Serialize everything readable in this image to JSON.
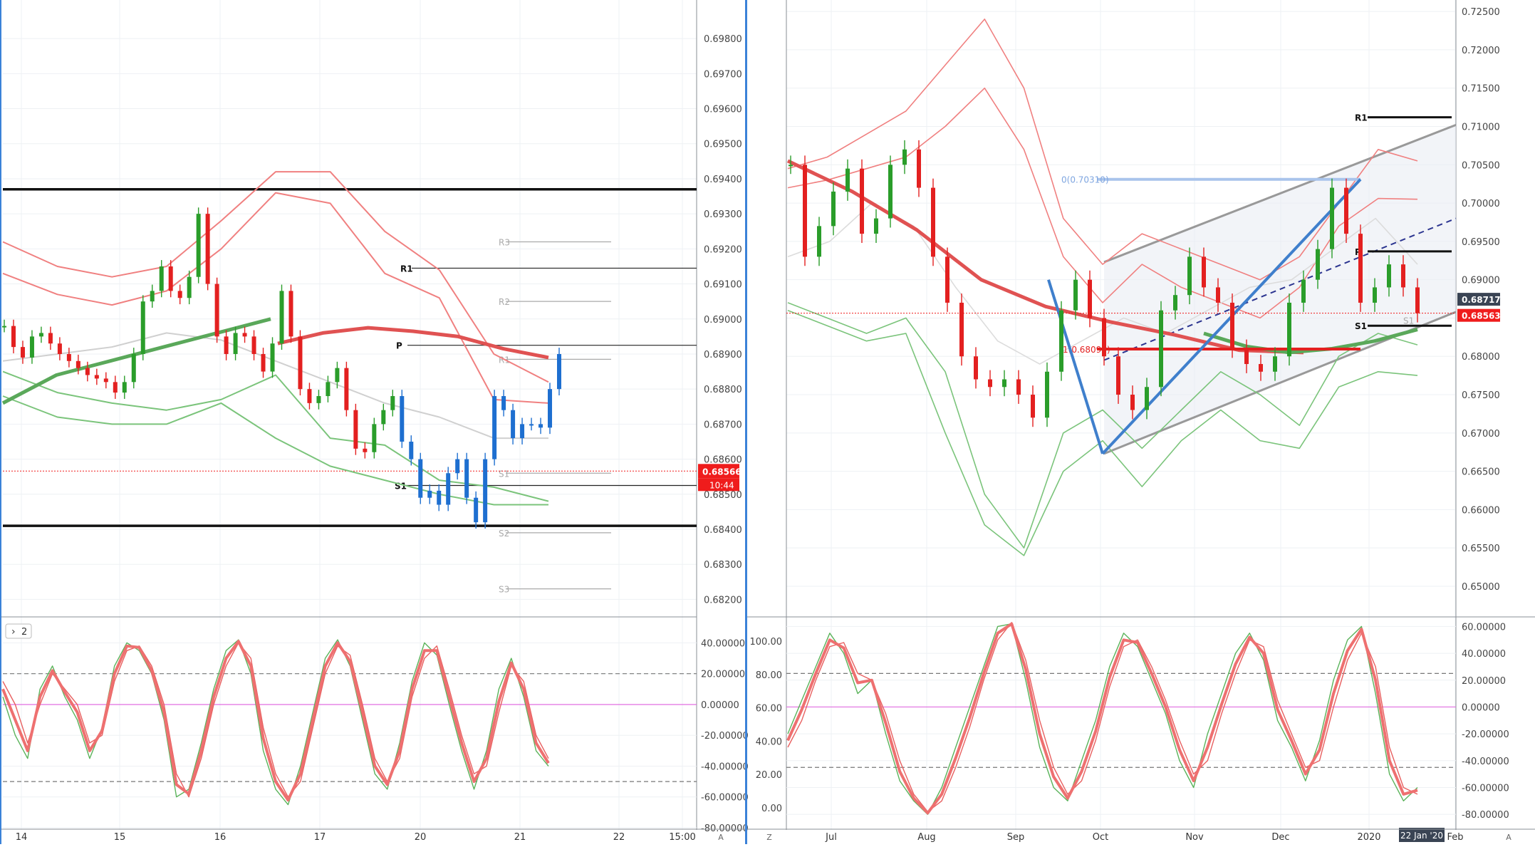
{
  "chart_data": [
    {
      "type": "candlestick",
      "panel": "left-main",
      "price_axis": {
        "ticks": [
          "0.69800",
          "0.69700",
          "0.69600",
          "0.69500",
          "0.69400",
          "0.69300",
          "0.69200",
          "0.69100",
          "0.69000",
          "0.68900",
          "0.68800",
          "0.68700",
          "0.68600",
          "0.68500",
          "0.68400",
          "0.68300",
          "0.68200"
        ],
        "ylim": [
          0.6815,
          0.6991
        ]
      },
      "time_axis": {
        "ticks": [
          "14",
          "15",
          "16",
          "17",
          "20",
          "21",
          "22",
          "15:00"
        ],
        "end_label": "A"
      },
      "current_price": {
        "value": 0.68566,
        "label": "0.68566",
        "countdown": "10:44",
        "color": "#ef1c1c"
      },
      "pivots": {
        "dark": [
          {
            "label": "R1",
            "value": 0.69145
          },
          {
            "label": "P",
            "value": 0.68925
          },
          {
            "label": "S1",
            "value": 0.68525
          }
        ],
        "gray": [
          {
            "label": "R3",
            "value": 0.6922
          },
          {
            "label": "R2",
            "value": 0.6905
          },
          {
            "label": "R1",
            "value": 0.68885
          },
          {
            "label": "S1",
            "value": 0.6856
          },
          {
            "label": "S2",
            "value": 0.6839
          },
          {
            "label": "S3",
            "value": 0.6823
          }
        ],
        "thick_horizontals": [
          0.6937,
          0.6841
        ]
      },
      "price_path": [
        0.6898,
        0.6892,
        0.6889,
        0.6895,
        0.6896,
        0.6893,
        0.689,
        0.6888,
        0.6886,
        0.6884,
        0.6883,
        0.6882,
        0.6879,
        0.6882,
        0.689,
        0.6905,
        0.6908,
        0.6915,
        0.6908,
        0.6906,
        0.6912,
        0.693,
        0.691,
        0.6895,
        0.689,
        0.6896,
        0.6895,
        0.689,
        0.6885,
        0.6893,
        0.6908,
        0.6895,
        0.688,
        0.6876,
        0.6878,
        0.6882,
        0.6886,
        0.6874,
        0.6863,
        0.6862,
        0.687,
        0.6874,
        0.6878,
        0.6865,
        0.686,
        0.6849,
        0.6851,
        0.6847,
        0.6856,
        0.686,
        0.6849,
        0.6842,
        0.686,
        0.6878,
        0.6874,
        0.6866,
        0.687,
        0.687,
        0.6869,
        0.688,
        0.689
      ],
      "overlays": {
        "ma_red": [
          0.6893,
          0.6896,
          0.68975,
          0.68965,
          0.6895,
          0.68915,
          0.6889
        ],
        "ma_green": [
          0.6876,
          0.6884,
          0.6888,
          0.6892,
          0.6896,
          0.69
        ],
        "bands_red": [
          [
            0.6922,
            0.6915,
            0.6912,
            0.6915,
            0.6928,
            0.6942,
            0.6942,
            0.6925,
            0.6914,
            0.689,
            0.6882
          ],
          [
            0.6913,
            0.6907,
            0.6904,
            0.6908,
            0.692,
            0.6936,
            0.6933,
            0.6913,
            0.6906,
            0.6877,
            0.6876
          ]
        ],
        "bands_green": [
          [
            0.6885,
            0.6879,
            0.6876,
            0.6874,
            0.6877,
            0.6884,
            0.6866,
            0.6864,
            0.6854,
            0.6852,
            0.6848
          ],
          [
            0.6878,
            0.6872,
            0.687,
            0.687,
            0.6876,
            0.6866,
            0.6858,
            0.6854,
            0.685,
            0.6847,
            0.6847
          ]
        ]
      },
      "oscillator": {
        "panel_label": "2",
        "ticks": [
          "40.00000",
          "20.00000",
          "0.00000",
          "-20.00000",
          "-40.00000",
          "-60.00000",
          "-80.00000"
        ],
        "ylim": [
          -80,
          55
        ],
        "dashed_levels": [
          20,
          -50
        ],
        "zero_line_color": "#e06ee0",
        "fast_line": [
          5,
          -20,
          -35,
          10,
          25,
          5,
          -10,
          -35,
          -15,
          25,
          40,
          35,
          20,
          -10,
          -60,
          -55,
          -25,
          10,
          35,
          42,
          20,
          -30,
          -55,
          -65,
          -40,
          -5,
          30,
          42,
          25,
          -10,
          -45,
          -55,
          -25,
          15,
          40,
          32,
          0,
          -30,
          -55,
          -30,
          10,
          30,
          5,
          -30,
          -40
        ],
        "slow_line": [
          15,
          0,
          -25,
          0,
          20,
          10,
          0,
          -25,
          -20,
          15,
          35,
          38,
          25,
          0,
          -45,
          -60,
          -35,
          0,
          25,
          40,
          30,
          -15,
          -45,
          -60,
          -50,
          -15,
          20,
          38,
          32,
          0,
          -35,
          -50,
          -35,
          5,
          30,
          38,
          10,
          -20,
          -45,
          -40,
          -5,
          25,
          15,
          -20,
          -35
        ],
        "main_line": [
          10,
          -10,
          -30,
          5,
          22,
          8,
          -5,
          -30,
          -17,
          20,
          38,
          37,
          22,
          -5,
          -52,
          -58,
          -30,
          5,
          30,
          41,
          25,
          -22,
          -50,
          -62,
          -45,
          -10,
          25,
          40,
          28,
          -5,
          -40,
          -52,
          -30,
          10,
          35,
          35,
          5,
          -25,
          -50,
          -35,
          2,
          27,
          10,
          -25,
          -38
        ]
      }
    },
    {
      "type": "candlestick",
      "panel": "right-main",
      "price_axis": {
        "ticks": [
          "0.72500",
          "0.72000",
          "0.71500",
          "0.71000",
          "0.70500",
          "0.70000",
          "0.69500",
          "0.69000",
          "0.68500",
          "0.68000",
          "0.67500",
          "0.67000",
          "0.66500",
          "0.66000",
          "0.65500",
          "0.65000"
        ],
        "ylim": [
          0.646,
          0.7265
        ]
      },
      "time_axis": {
        "ticks": [
          "Jul",
          "Aug",
          "Sep",
          "Oct",
          "Nov",
          "Dec",
          "2020",
          "Feb"
        ],
        "hover_label": "22 Jan '20",
        "start_label": "Z",
        "end_label": "A"
      },
      "price_labels": [
        {
          "label": "0.68717",
          "value": 0.68717,
          "color": "#3a4454"
        },
        {
          "label": "0.68563",
          "value": 0.68563,
          "color": "#ef1c1c"
        }
      ],
      "fibonacci": [
        {
          "label": "0(0.70310)",
          "value": 0.7031
        },
        {
          "label": "1(0.68095)",
          "value": 0.68095
        }
      ],
      "pivots": [
        {
          "label": "R1",
          "value": 0.7112
        },
        {
          "label": "P",
          "value": 0.6937
        },
        {
          "label": "S1",
          "value": 0.684
        }
      ],
      "gray_pivot_labels": [
        {
          "label": "S1",
          "value": 0.6847
        }
      ],
      "price_path": [
        0.705,
        0.693,
        0.697,
        0.7015,
        0.7045,
        0.696,
        0.698,
        0.705,
        0.707,
        0.702,
        0.693,
        0.687,
        0.68,
        0.677,
        0.676,
        0.677,
        0.675,
        0.672,
        0.678,
        0.686,
        0.69,
        0.685,
        0.68,
        0.675,
        0.673,
        0.676,
        0.686,
        0.688,
        0.693,
        0.689,
        0.687,
        0.681,
        0.679,
        0.678,
        0.68,
        0.687,
        0.69,
        0.694,
        0.702,
        0.696,
        0.687,
        0.689,
        0.692,
        0.689,
        0.68563
      ],
      "overlays": {
        "ma_red": [
          0.7055,
          0.7015,
          0.6965,
          0.69,
          0.6865,
          0.6845,
          0.6828,
          0.6808,
          0.6805
        ],
        "ma_green": [
          0.683,
          0.6813,
          0.6805,
          0.681,
          0.682,
          0.6835
        ],
        "channel": {
          "upper": [
            [
              0.6923,
              "Sep mid"
            ],
            [
              0.7102,
              "Feb end"
            ]
          ],
          "lower": [
            [
              0.6673,
              "Oct"
            ],
            [
              0.6858,
              "Feb end"
            ]
          ],
          "mid_dashed": [
            [
              0.6795,
              "Oct"
            ],
            [
              0.698,
              "Feb end"
            ]
          ]
        },
        "blue_lines": [
          [
            0.69,
            0.6673
          ],
          [
            0.6673,
            0.7031
          ]
        ]
      },
      "oscillator": {
        "left_ticks": [
          "100.00",
          "80.00",
          "60.00",
          "40.00",
          "20.00",
          "0.00"
        ],
        "right_ticks": [
          "60.00000",
          "40.00000",
          "20.00000",
          "0.00000",
          "-20.00000",
          "-40.00000",
          "-60.00000",
          "-80.00000"
        ],
        "ylim": [
          -90,
          65
        ],
        "dashed_levels": [
          25,
          -45
        ],
        "zero_line_color": "#e06ee0",
        "fast_line": [
          -20,
          5,
          30,
          55,
          40,
          10,
          20,
          -20,
          -55,
          -70,
          -80,
          -60,
          -30,
          0,
          30,
          60,
          62,
          20,
          -30,
          -60,
          -70,
          -40,
          -10,
          30,
          55,
          45,
          20,
          -5,
          -40,
          -60,
          -20,
          10,
          40,
          55,
          35,
          -10,
          -30,
          -55,
          -25,
          20,
          50,
          60,
          10,
          -50,
          -70,
          -60
        ],
        "slow_line": [
          -30,
          -10,
          20,
          45,
          48,
          25,
          20,
          -5,
          -40,
          -65,
          -78,
          -70,
          -45,
          -15,
          20,
          50,
          63,
          35,
          -10,
          -45,
          -65,
          -55,
          -25,
          15,
          45,
          50,
          30,
          5,
          -25,
          -50,
          -40,
          -5,
          25,
          50,
          45,
          5,
          -20,
          -45,
          -40,
          0,
          35,
          55,
          30,
          -30,
          -60,
          -65
        ],
        "main_line": [
          -25,
          -2,
          25,
          50,
          44,
          18,
          20,
          -12,
          -48,
          -68,
          -79,
          -65,
          -38,
          -8,
          25,
          55,
          62,
          28,
          -20,
          -52,
          -68,
          -48,
          -18,
          22,
          50,
          48,
          25,
          0,
          -32,
          -55,
          -30,
          2,
          32,
          52,
          40,
          -2,
          -25,
          -50,
          -32,
          10,
          42,
          58,
          20,
          -40,
          -65,
          -62
        ]
      }
    }
  ]
}
